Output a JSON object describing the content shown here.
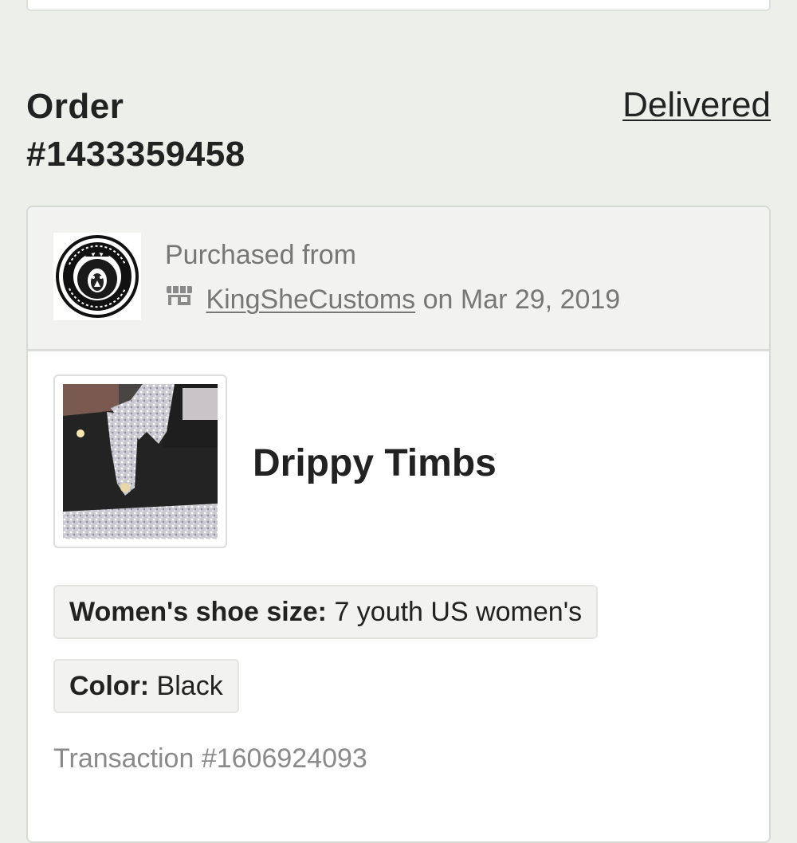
{
  "order": {
    "title_line1": "Order",
    "title_line2": "#1433359458",
    "status": "Delivered"
  },
  "shop": {
    "purchased_label": "Purchased from",
    "name": "KingSheCustoms",
    "date_text": "on Mar 29, 2019",
    "logo_icon": "lion-crest-logo",
    "store_icon": "storefront-icon"
  },
  "item": {
    "title": "Drippy Timbs",
    "variations": [
      {
        "label": "Women's shoe size:",
        "value": "7 youth US women's"
      },
      {
        "label": "Color:",
        "value": "Black"
      }
    ],
    "transaction": "Transaction #1606924093"
  },
  "colors": {
    "background": "#ecefea",
    "text": "#222222",
    "muted": "#777777"
  }
}
